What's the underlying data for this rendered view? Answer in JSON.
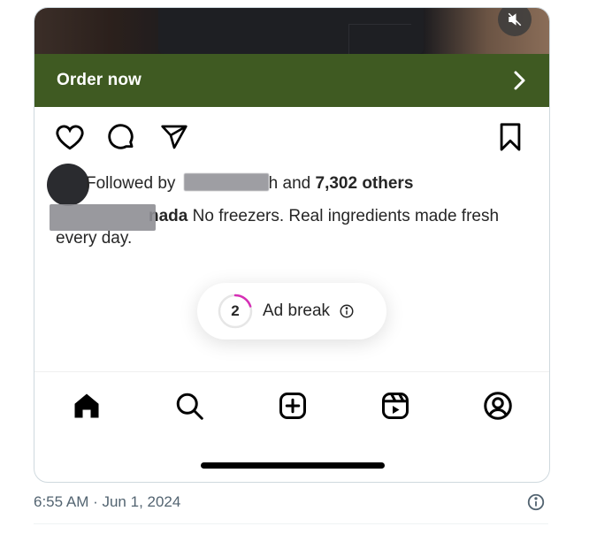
{
  "post": {
    "cta_label": "Order now",
    "followed_prefix": "Followed by",
    "followed_suffix_fragment": "h and",
    "followed_count": "7,302 others",
    "caption_user_fragment": "nada",
    "caption_text": "No freezers. Real ingredients made fresh every day."
  },
  "ad_break": {
    "countdown": "2",
    "label": "Ad break",
    "progress_fraction": 0.2,
    "accent_color": "#d62fb5"
  },
  "nav": {
    "items": [
      "home-icon",
      "search-icon",
      "create-icon",
      "reels-icon",
      "profile-icon"
    ]
  },
  "tweet": {
    "timestamp": "6:55 AM · Jun 1, 2024"
  },
  "colors": {
    "cta_background": "#3f5a22",
    "text_primary": "#262626",
    "meta_text": "#536471"
  }
}
